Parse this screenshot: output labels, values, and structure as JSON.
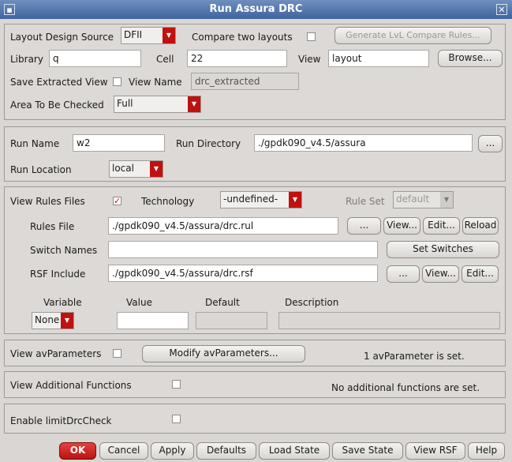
{
  "window": {
    "title": "Run Assura DRC",
    "close_glyph": "✕"
  },
  "design": {
    "layout_source_label": "Layout Design Source",
    "layout_source_value": "DFII",
    "compare_label": "Compare two layouts",
    "generate_button": "Generate LvL Compare Rules...",
    "library_label": "Library",
    "library_value": "q",
    "cell_label": "Cell",
    "cell_value": "22",
    "view_label": "View",
    "view_value": "layout",
    "browse_button": "Browse...",
    "save_extracted_label": "Save Extracted View",
    "view_name_label": "View Name",
    "view_name_value": "drc_extracted",
    "area_label": "Area To Be Checked",
    "area_value": "Full"
  },
  "run": {
    "run_name_label": "Run Name",
    "run_name_value": "w2",
    "run_dir_label": "Run Directory",
    "run_dir_value": "./gpdk090_v4.5/assura",
    "browse_small": "...",
    "location_label": "Run Location",
    "location_value": "local"
  },
  "rules": {
    "view_rules_label": "View Rules Files",
    "view_rules_checked": true,
    "technology_label": "Technology",
    "technology_value": "-undefined-",
    "rule_set_label": "Rule Set",
    "rule_set_value": "default",
    "rules_file_label": "Rules File",
    "rules_file_value": "./gpdk090_v4.5/assura/drc.rul",
    "dots_button": "...",
    "view_button": "View...",
    "edit_button": "Edit...",
    "reload_button": "Reload",
    "switch_names_label": "Switch Names",
    "switch_names_value": "",
    "set_switches_button": "Set Switches",
    "rsf_include_label": "RSF Include",
    "rsf_include_value": "./gpdk090_v4.5/assura/drc.rsf",
    "variable_header": "Variable",
    "value_header": "Value",
    "default_header": "Default",
    "description_header": "Description",
    "variable_value": "None"
  },
  "avparams": {
    "label": "View avParameters",
    "modify_button": "Modify avParameters...",
    "status": "1 avParameter is set."
  },
  "additional": {
    "label": "View Additional Functions",
    "status": "No additional functions are set."
  },
  "limit": {
    "label": "Enable limitDrcCheck"
  },
  "footer": {
    "ok": "OK",
    "cancel": "Cancel",
    "apply": "Apply",
    "defaults": "Defaults",
    "load_state": "Load State",
    "save_state": "Save State",
    "view_rsf": "View RSF",
    "help": "Help"
  },
  "colors": {
    "accent_red": "#c0110e",
    "titlebar": "#4f73aa"
  }
}
